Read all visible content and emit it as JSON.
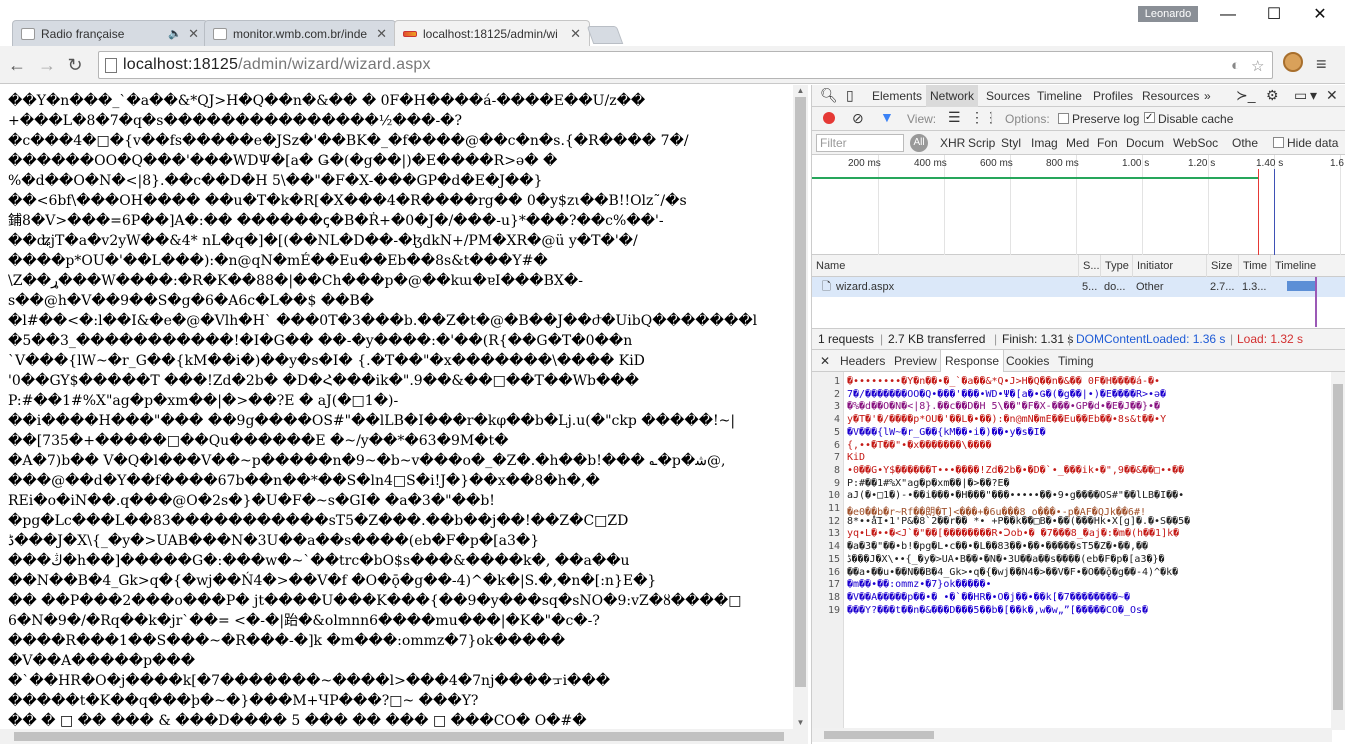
{
  "window": {
    "profile_name": "Leonardo",
    "minimize": "—",
    "maximize": "☐",
    "close": "✕"
  },
  "tabs": [
    {
      "label": "Radio française",
      "icon": "document-icon",
      "extra": "🔈"
    },
    {
      "label": "monitor.wmb.com.br/inde",
      "icon": "document-icon"
    },
    {
      "label": "localhost:18125/admin/wi",
      "icon": "wmb-favicon",
      "active": true
    }
  ],
  "toolbar": {
    "back": "←",
    "forward": "→",
    "reload": "↻",
    "url_host": "localhost:18125",
    "url_path": "/admin/wizard/wizard.aspx",
    "star": "☆",
    "menu": "≡"
  },
  "page": {
    "lines": [
      "��Y�n���_`�a��&*QJ>H�Q��n�&�� � 0F�H����á-����E��U/z��",
      "+���L�8�7�q�s���������������½���-�?",
      "�c���4�□�{v��fs�����e�JSz�'��BK�_�f����@��c�n�s.{�R���� 7�/",
      "������OO�Q���'���WDΨ�[a� Ǥ�(�g��|)�E����R>ә� �",
      "%�d��O�N�<|8}.��c��D�H 5\\��\"�F�X-���GP�d�E�J��}",
      "��<6bf\\���OH���� ��u�T�k�R[�X���4�R����rg�� 0�y$zι��B!!Olz˜/�s",
      "鋪8�V>���=6P��]A�:�� ������ꞔ�B�Ṙ+�0�J�/���-u}*���?��c%��'-",
      "��ʥjT�a�v2yW��&4* nL�q�]�[(��NL�D��-�ɮdkN+/PM�XR�@ü y�T�'�/",
      "����p*OU�'��L���):�n@qN�mÉ��Eu��Eb��8s&t���Y#�",
      "\\Z��ړ���W����:�R�K��88�|��Ch���p�@��kɯ�ɐI���BX�-",
      "s��@h�V��9��S�g�6�A6c�L��$ ��B�",
      "�l#��<�:l��I&�e�@�Vlh�H` ���0T�3���b.��Z�t�@�B��J��ժ�UibQ�������l",
      "�5��3_�����������!�I�G�� ��-�y����:�'��(R{��G�T�0��n",
      "`V���{lW~�r_G��{kM��i�)��y�s�I� {.�T��\"�x�������\\���� KiD",
      "'0��GY$�����T ���!Zd�2b� �D�Հ���ik�\".9��&��□��T��Wb���",
      "P:#��1#%X\"ag�p�xm��|�>��?E � aJ(�□1�)-",
      "��i����H���\"��� ��9g����OS#\"��lLB�I���r�kφ��b�Lj.u(�\"ckp �����!~|",
      "��[735�+�����□��Qu������E �~/y��*�63�9M�t�",
      "�A�7)b�� V�Q�l���V��~p�����n�9~�b~v���o�_�Z�.�h��b!��� ؎�p�ﺷ@,",
      "���@��d�Y��f����67b��n��*��S�ln4□S�i!J�}��x��8�h�,�",
      "REi�o�iN��.q���@O�2s�}�U�F�~s�GI� �a�3�\"��b!",
      "�pg�Lc���L��83�����������sT5�Z���.��b��j��!��Z�C□ZD",
      "ڈ���J�X\\{_�y�>UAB���N�3U��a��s����(eb�F�p�[a3�}",
      "���ڭ�h��]�����G�:���w�~`��trc�bO$s���&����k�, ��a��u",
      "��N��B�4_Gk>q�{�wj��Ń4�>��V�f �O�ǭ�g��-4)^�k�|S.�,�n�[:n}E�}",
      "�� ��P���2���o���P� jt����U���K���{��9�y���sq�sNO�9:vZ�ȣ����□",
      "6�N�9�/�Rq��k�jr`��= <�-�|跆�&olmnn6����mu���|�K�\"�c�-?",
      "����R���1��S���~�R���-�]k �m���:ommz�7}ok�����",
      "�V��A�����p���",
      "�`��HR�O�j����k[�7�������~����l>���4�7nj����ᠴi���",
      "�����t�K��q���þ�~�}���M+ЧP���?□~ ���Y?",
      "�� � □ �� ��� & ���D���� 5 ��� �� ��� □ ���CO� O�#�"
    ]
  },
  "devtools": {
    "tabs": [
      "Elements",
      "Network",
      "Sources",
      "Timeline",
      "Profiles",
      "Resources"
    ],
    "more": "»",
    "view_label": "View:",
    "options_label": "Options:",
    "preserve_log": "Preserve log",
    "disable_cache": "Disable cache",
    "filter_placeholder": "Filter",
    "all_label": "All",
    "types": [
      "XHR",
      "Scrip",
      "Styl",
      "Imag",
      "Med",
      "Fon",
      "Docum",
      "WebSoc",
      "Othe"
    ],
    "hide_data": "Hide data",
    "ticks": [
      "200 ms",
      "400 ms",
      "600 ms",
      "800 ms",
      "1.00 s",
      "1.20 s",
      "1.40 s",
      "1.6"
    ],
    "columns": [
      "Name",
      "S...",
      "Type",
      "Initiator",
      "Size",
      "Time",
      "Timeline"
    ],
    "row": {
      "name": "wizard.aspx",
      "status": "5...",
      "type": "do...",
      "initiator": "Other",
      "size": "2.7...",
      "time": "1.3..."
    },
    "status": {
      "requests": "1 requests",
      "transferred": "2.7 KB transferred",
      "finish": "Finish: 1.31 s",
      "dcl": "DOMContentLoaded: 1.36 s",
      "load": "Load: 1.32 s"
    },
    "detail_tabs": [
      "Headers",
      "Preview",
      "Response",
      "Cookies",
      "Timing"
    ],
    "response_lines": [
      "�••••••••�Y�n��•�_`�a��&*Q•J>H�Q��n�&��  0F�H����á-�•",
      "7�/�������OO�Q•���'���•WD•Ψ�[a�•Ǥ�(�g��|•)�E����R>•ә�",
      "�%�d��O�N�<|8}.��c��D�H    5\\��\"�F�X-���•GP�d•�E�J��}•�",
      "y�T�'�/����p*OU�'��L�•��):�n@mN�mÉ��Eu��Eb��•8s&t��•Y",
      "�V���{lW~�r_G��{kM��•i�)��•y�s�I�",
      "{,••�T��\"•�x�������\\����",
      "KiD",
      "•0��G•Y$������T•••����!Zd�2b�•�D�`•_���ik•�\",9��&��□••��",
      "P:#��1#%X\"ag�p�xm��|�>��?E�",
      "aJ(�•□1�)-•��i���•�H���\"���•••••��•9•g����OS#\"��lLB�I��•",
      "�e0��b�r~Rf��朗�T]<���+�6u���8_o���•-p�AF�QJk��6#!",
      "8*••å͞I•1'P&�8`2��r�� *• +P��k��□B�•��(���Hk•X[g]�.�•S��5�",
      "yq•L�••�<J`�\"��[��������R•Ↄob•� �7���8_�aj�:�m�(h��1]k�",
      "�a�3�\"��•b!�pg�L•c��•�L��83��•��•�����sT5�Z�•��,��",
      "ڈ���J�X\\••{_�y�>UA•B��•�N�•3U��a��s����(eb�F�p�[a3�}�",
      "��a•��u•��N��B�4_Gk>•q�{�wj��Ń4�>��V�F•�O��ǭ�g��-4)^�k�",
      "�m��•��:ommz•�7}ok�����•",
      "�V��A�����p��•�   •�`��HR�•O�j��•��k[�7��������~�",
      "���Y?���t��n�&���D���5��b�[��k�,w�w„”[�����CO�_Os�"
    ]
  }
}
